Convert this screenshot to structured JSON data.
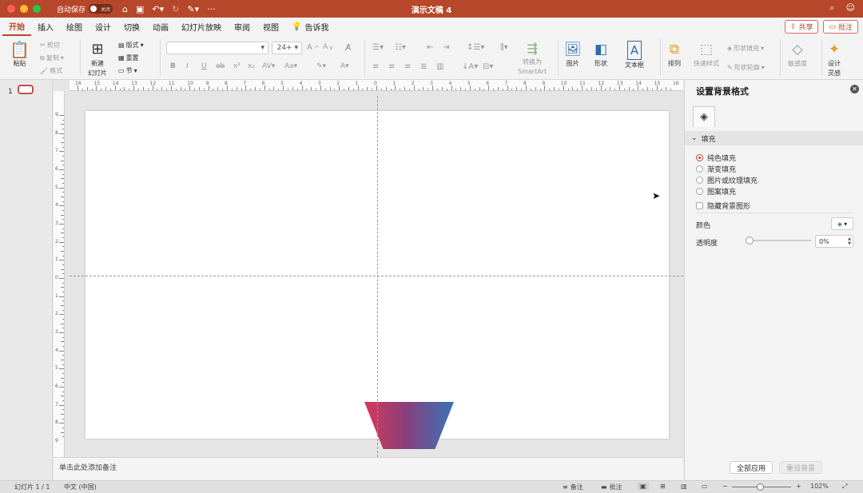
{
  "titlebar": {
    "autosave_label": "自动保存",
    "toggle_state": "关闭",
    "doc_title": "演示文稿 4"
  },
  "tabs": [
    "开始",
    "插入",
    "绘图",
    "设计",
    "切换",
    "动画",
    "幻灯片放映",
    "审阅",
    "视图"
  ],
  "tell_me": "告诉我",
  "share": {
    "share_label": "共享",
    "comment_label": "批注"
  },
  "ribbon": {
    "paste": "粘贴",
    "cut": "剪切",
    "copy": "复制",
    "format": "格式",
    "new_slide_line1": "新建",
    "new_slide_line2": "幻灯片",
    "layout": "版式",
    "reset": "重置",
    "section": "节",
    "font_size": "24+",
    "convert_line1": "转换为",
    "convert_line2": "SmartArt",
    "picture": "图片",
    "shape": "形状",
    "textbox": "文本框",
    "arrange": "排列",
    "quick_styles": "快速样式",
    "shape_fill": "形状填充",
    "shape_outline": "形状轮廓",
    "sensitivity": "敏感度",
    "designer_line1": "设计",
    "designer_line2": "灵感"
  },
  "thumbs": {
    "slide_number": "1"
  },
  "ruler": {
    "h_labels": [
      "16",
      "15",
      "14",
      "13",
      "12",
      "11",
      "10",
      "9",
      "8",
      "7",
      "6",
      "5",
      "4",
      "3",
      "2",
      "1",
      "0",
      "1",
      "2",
      "3",
      "4",
      "5",
      "6",
      "7",
      "8",
      "9",
      "10",
      "11",
      "12",
      "13",
      "14",
      "15",
      "16"
    ],
    "v_labels": [
      "9",
      "8",
      "7",
      "6",
      "5",
      "4",
      "3",
      "2",
      "1",
      "0",
      "1",
      "2",
      "3",
      "4",
      "5",
      "6",
      "7",
      "8",
      "9"
    ]
  },
  "notes": {
    "placeholder": "单击此处添加备注"
  },
  "format_pane": {
    "title": "设置背景格式",
    "section_fill": "填充",
    "options": [
      "纯色填充",
      "渐变填充",
      "图片或纹理填充",
      "图案填充"
    ],
    "selected_option": "纯色填充",
    "hide_bg": "隐藏背景图形",
    "color_label": "颜色",
    "transparency_label": "透明度",
    "transparency_value": "0%",
    "transparency_level": 0,
    "apply_all": "全部应用",
    "reset_bg": "重设背景"
  },
  "statusbar": {
    "slide_info": "幻灯片 1 / 1",
    "language": "中文 (中国)",
    "notes": "备注",
    "comments": "批注",
    "zoom": "102%",
    "zoom_level": 0.47
  },
  "colors": {
    "accent": "#b7472a",
    "gradient_start": "#d53a5a",
    "gradient_mid": "#8a3f7a",
    "gradient_end": "#3a72b8"
  }
}
